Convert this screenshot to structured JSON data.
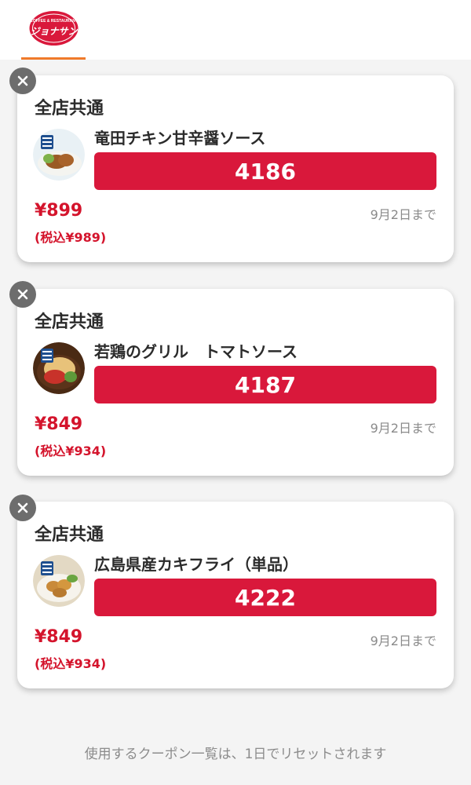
{
  "header": {
    "logo_name": "coffee-restaurant-logo",
    "logo_text_top": "COFFEE & RESTAURANT",
    "logo_text_main": "ジョナサン"
  },
  "coupons": [
    {
      "store": "全店共通",
      "name": "竜田チキン甘辛醤ソース",
      "code": "4186",
      "price": "¥899",
      "price_tax": "(税込¥989)",
      "expiry": "9月2日まで"
    },
    {
      "store": "全店共通",
      "name": "若鶏のグリル　トマトソース",
      "code": "4187",
      "price": "¥849",
      "price_tax": "(税込¥934)",
      "expiry": "9月2日まで"
    },
    {
      "store": "全店共通",
      "name": "広島県産カキフライ（単品）",
      "code": "4222",
      "price": "¥849",
      "price_tax": "(税込¥934)",
      "expiry": "9月2日まで"
    }
  ],
  "footer": {
    "note": "使用するクーポン一覧は、1日でリセットされます"
  },
  "colors": {
    "accent_red": "#d9183b",
    "price_red": "#d4142c",
    "tab_orange": "#f07a2a"
  }
}
